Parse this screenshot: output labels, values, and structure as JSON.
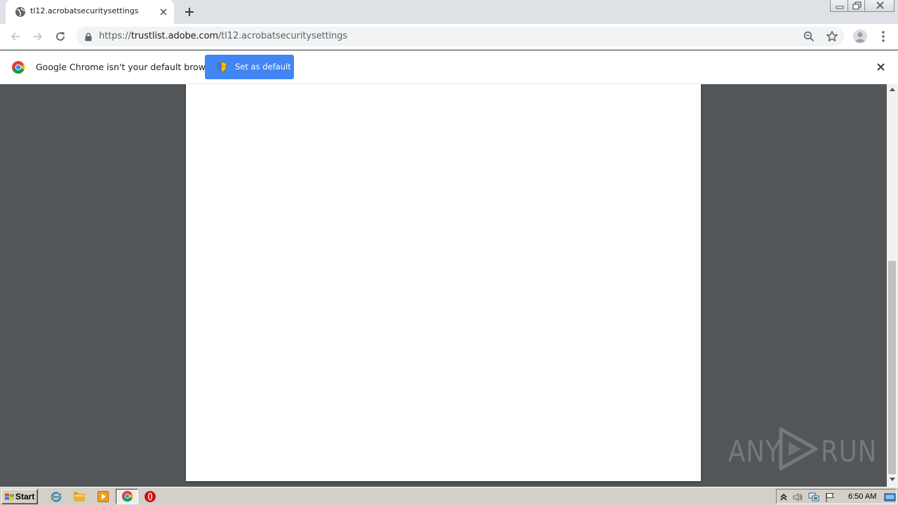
{
  "tab": {
    "title": "tl12.acrobatsecuritysettings"
  },
  "omnibox": {
    "scheme": "https://",
    "host": "trustlist.adobe.com",
    "path": "/tl12.acrobatsecuritysettings"
  },
  "infobar": {
    "message": "Google Chrome isn't your default browser",
    "button_label": "Set as default"
  },
  "watermark": {
    "left_text": "ANY",
    "right_text": "RUN"
  },
  "taskbar": {
    "start_label": "Start",
    "clock": "6:50 AM",
    "pinned": [
      "internet-explorer-icon",
      "explorer-icon",
      "media-player-icon",
      "chrome-icon",
      "opera-icon"
    ]
  },
  "colors": {
    "accent": "#4285f4",
    "viewer_bg": "#525659",
    "tabstrip_bg": "#dee1e6",
    "taskbar_bg": "#d4d0c8"
  }
}
